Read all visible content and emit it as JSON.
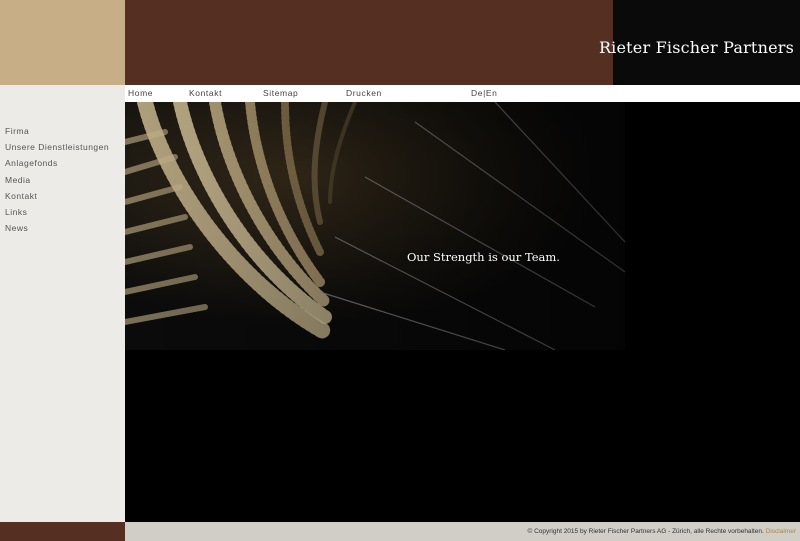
{
  "site": {
    "logo_text": "Rieter Fischer Partners"
  },
  "colors": {
    "brown": "#552f21",
    "tan": "#c7ae86",
    "sidebar": "#ecebe8",
    "footer": "#d1cec8",
    "accent": "#a8894f"
  },
  "topnav": {
    "items": [
      {
        "label": "Home"
      },
      {
        "label": "Kontakt"
      },
      {
        "label": "Sitemap"
      },
      {
        "label": "Drucken"
      }
    ],
    "lang_de": "De",
    "lang_sep": "|",
    "lang_en": "En"
  },
  "sidebar": {
    "items": [
      {
        "label": "Firma"
      },
      {
        "label": "Unsere Dienstleistungen"
      },
      {
        "label": "Anlagefonds"
      },
      {
        "label": "Media"
      },
      {
        "label": "Kontakt"
      },
      {
        "label": "Links"
      },
      {
        "label": "News"
      }
    ]
  },
  "hero": {
    "tagline": "Our Strength is our Team."
  },
  "footer": {
    "copyright": "© Copyright 2015 by Rieter Fischer Partners AG - Zürich, alle Rechte vorbehalten.",
    "disclaimer": "Disclaimer"
  }
}
